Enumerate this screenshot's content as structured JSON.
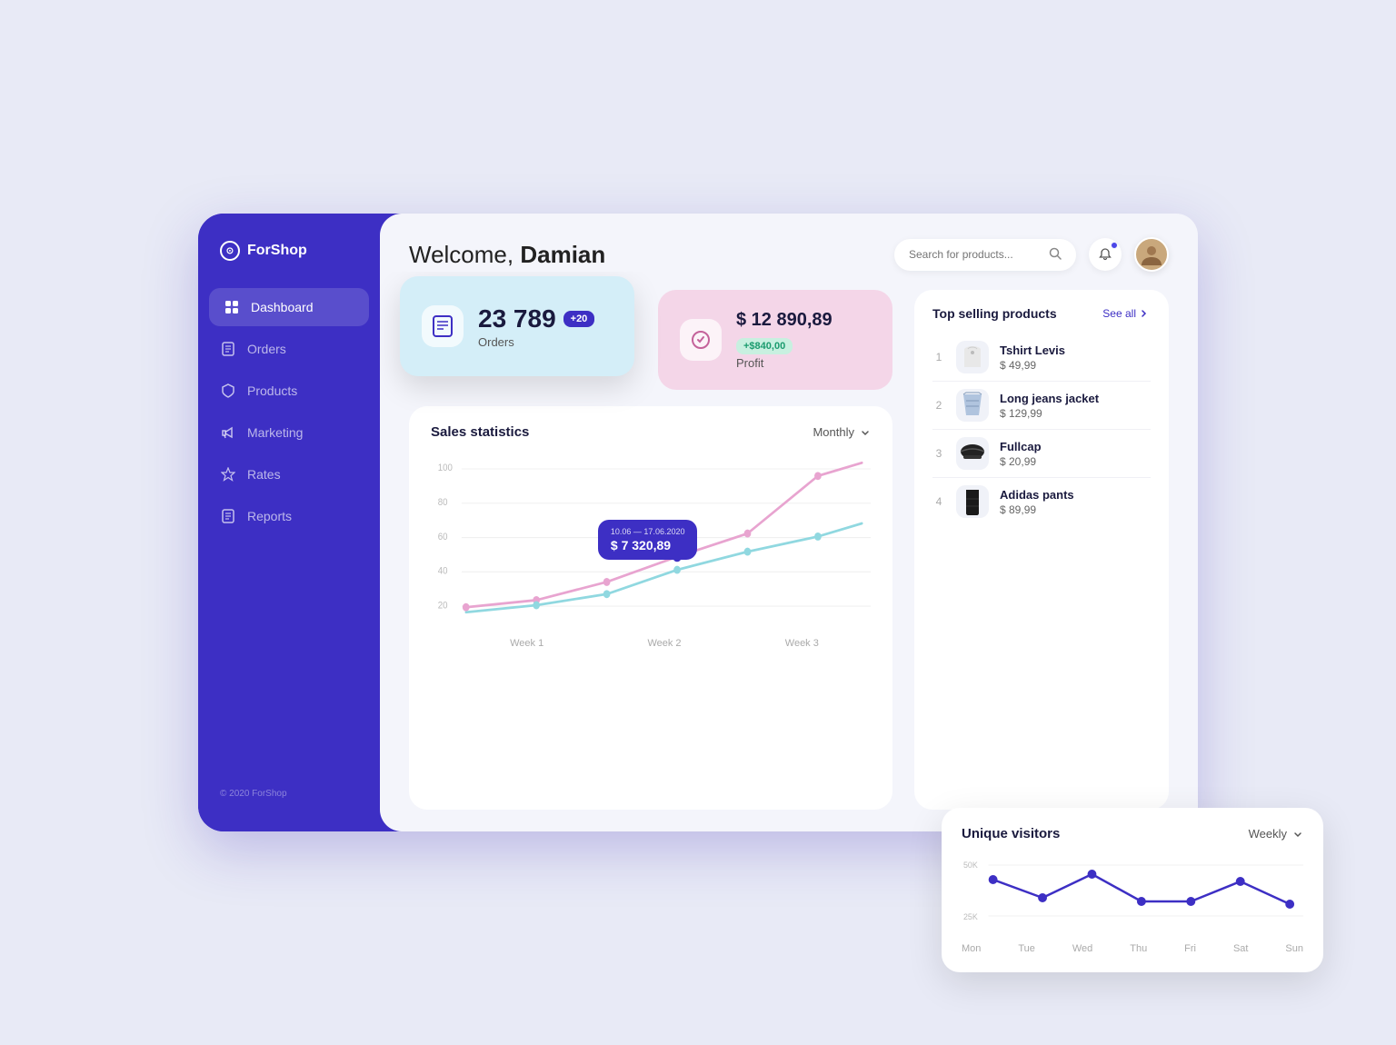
{
  "app": {
    "name": "ForShop",
    "footer": "© 2020 ForShop"
  },
  "sidebar": {
    "logo_icon": "⊙",
    "items": [
      {
        "id": "dashboard",
        "label": "Dashboard",
        "icon": "📅",
        "active": true
      },
      {
        "id": "orders",
        "label": "Orders",
        "icon": "📋",
        "active": false
      },
      {
        "id": "products",
        "label": "Products",
        "icon": "🎁",
        "active": false
      },
      {
        "id": "marketing",
        "label": "Marketing",
        "icon": "📢",
        "active": false
      },
      {
        "id": "rates",
        "label": "Rates",
        "icon": "⭐",
        "active": false
      },
      {
        "id": "reports",
        "label": "Reports",
        "icon": "📄",
        "active": false
      }
    ]
  },
  "header": {
    "welcome_prefix": "Welcome, ",
    "welcome_name": "Damian",
    "search_placeholder": "Search for products...",
    "search_icon": "🔍"
  },
  "stats": {
    "orders": {
      "number": "23 789",
      "badge": "+20",
      "label": "Orders",
      "icon": "🧾"
    },
    "profit": {
      "number": "$ 12 890,89",
      "badge": "+$840,00",
      "label": "Profit",
      "icon": "🎀"
    }
  },
  "sales_chart": {
    "title": "Sales statistics",
    "period": "Monthly",
    "tooltip_date": "10.06 — 17.06.2020",
    "tooltip_value": "$ 7 320,89",
    "y_labels": [
      "100",
      "80",
      "60",
      "40",
      "20"
    ],
    "x_labels": [
      "Week 1",
      "Week 2",
      "Week 3"
    ]
  },
  "top_products": {
    "title": "Top selling products",
    "see_all": "See all",
    "items": [
      {
        "rank": "1",
        "name": "Tshirt Levis",
        "price": "$ 49,99",
        "emoji": "👕"
      },
      {
        "rank": "2",
        "name": "Long jeans jacket",
        "price": "$ 129,99",
        "emoji": "🧥"
      },
      {
        "rank": "3",
        "name": "Fullcap",
        "price": "$ 20,99",
        "emoji": "🧢"
      },
      {
        "rank": "4",
        "name": "Adidas pants",
        "price": "$ 89,99",
        "emoji": "👖"
      }
    ]
  },
  "unique_visitors": {
    "title": "Unique visitors",
    "period": "Weekly",
    "y_labels": [
      "50K",
      "25K"
    ],
    "x_labels": [
      "Mon",
      "Tue",
      "Wed",
      "Thu",
      "Fri",
      "Sat",
      "Sun"
    ]
  },
  "colors": {
    "primary": "#3d2fc4",
    "sidebar_bg": "#3d2fc4",
    "orders_card_bg": "#d4eef8",
    "profit_card_bg": "#f4d6e8",
    "chart_line1": "#c8a4e0",
    "chart_line2": "#a0d8e8",
    "visitors_line": "#3d2fc4"
  }
}
